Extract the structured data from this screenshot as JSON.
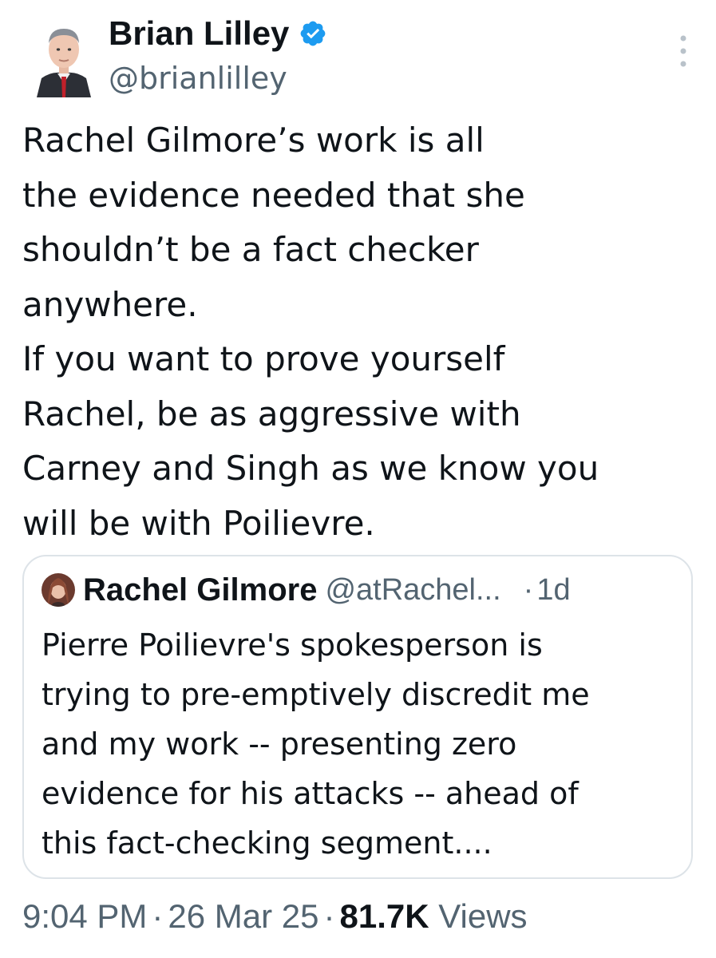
{
  "author": {
    "display_name": "Brian Lilley",
    "handle": "@brianlilley",
    "verified": true,
    "avatar_icon": "profile-photo"
  },
  "tweet": {
    "text": "Rachel Gilmore’s work is all\nthe evidence needed that she\nshouldn’t be a fact checker\nanywhere.\nIf you want to prove yourself\nRachel, be as aggressive with\nCarney and Singh as we know you\nwill be with Poilievre."
  },
  "quoted_tweet": {
    "display_name": "Rachel Gilmore",
    "handle": "@atRachel...",
    "separator": "·",
    "time": "1d",
    "text": "Pierre Poilievre's spokesperson is\ntrying to pre-emptively discredit me\nand my work -- presenting zero\nevidence for his attacks -- ahead of\nthis fact-checking segment...."
  },
  "meta": {
    "time": "9:04 PM",
    "sep1": "·",
    "date": "26 Mar 25",
    "sep2": "·",
    "views_count": "81.7K",
    "views_label": "Views"
  },
  "colors": {
    "text": "#0f1419",
    "secondary": "#536471",
    "verified": "#1d9bf0",
    "border": "#dde3e8"
  }
}
